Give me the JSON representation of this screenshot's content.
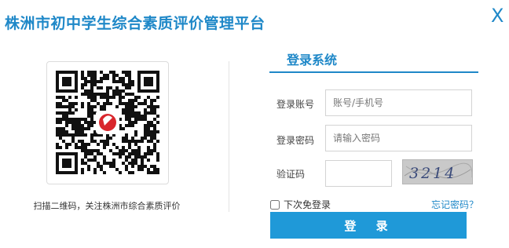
{
  "header": {
    "title": "株洲市初中学生综合素质评价管理平台",
    "close_label": "X"
  },
  "qr": {
    "icon": "qr-code-icon",
    "caption": "扫描二维码，关注株洲市综合素质评价"
  },
  "login": {
    "title": "登录系统",
    "account": {
      "label": "登录账号",
      "placeholder": "账号/手机号",
      "value": ""
    },
    "password": {
      "label": "登录密码",
      "placeholder": "请输入密码",
      "value": ""
    },
    "captcha": {
      "label": "验证码",
      "value": "",
      "image_text": "3214"
    },
    "remember_label": "下次免登录",
    "forgot_label": "忘记密码？",
    "submit_label": "登 录"
  },
  "colors": {
    "accent": "#1f88c8",
    "button": "#1f99d8",
    "qr_logo": "#d9262c"
  }
}
